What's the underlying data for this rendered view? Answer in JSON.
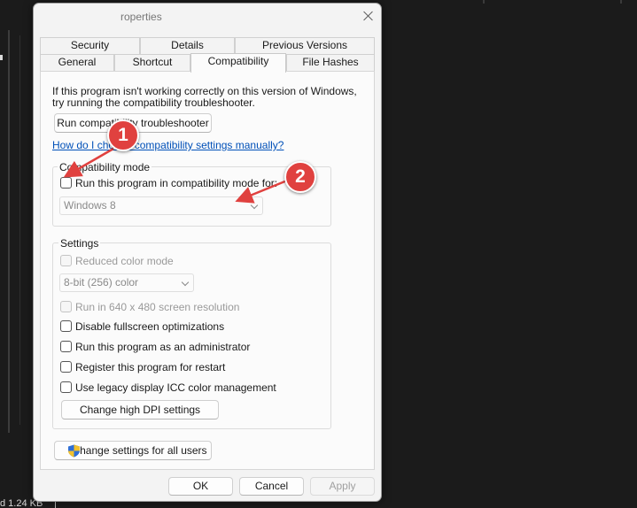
{
  "window": {
    "title": "roperties",
    "status_text": "d  1.24 KB"
  },
  "tabs_row1": [
    "Security",
    "Details",
    "Previous Versions"
  ],
  "tabs_row2": [
    "General",
    "Shortcut",
    "Compatibility",
    "File Hashes"
  ],
  "intro_line1": "If this program isn't working correctly on this version of Windows,",
  "intro_line2": "try running the compatibility troubleshooter.",
  "troubleshooter_button": "Run compatibility troubleshooter",
  "manual_link": "How do I choose compatibility settings manually?",
  "compat_mode": {
    "group_label": "Compatibility mode",
    "checkbox_label": "Run this program in compatibility mode for:",
    "selected_os": "Windows 8"
  },
  "settings": {
    "group_label": "Settings",
    "reduced_color": "Reduced color mode",
    "color_depth": "8-bit (256) color",
    "resolution": "Run in 640 x 480 screen resolution",
    "disable_fullscreen": "Disable fullscreen optimizations",
    "run_admin": "Run this program as an administrator",
    "register_restart": "Register this program for restart",
    "legacy_icc": "Use legacy display ICC color management",
    "dpi_button": "Change high DPI settings"
  },
  "all_users_button": "Change settings for all users",
  "footer": {
    "ok": "OK",
    "cancel": "Cancel",
    "apply": "Apply"
  },
  "annotations": {
    "badge1": "1",
    "badge2": "2",
    "color": "#e0413f"
  }
}
